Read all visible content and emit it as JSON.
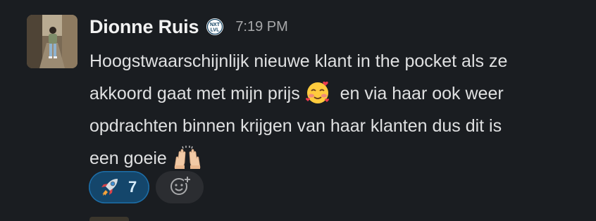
{
  "message": {
    "author": "Dionne Ruis",
    "status_badge_text": "NXT LVL",
    "timestamp": "7:19 PM",
    "lines": [
      "Hoogstwaarschijnlijk nieuwe klant in the pocket als ze",
      "akkoord gaat met mijn prijs",
      "en via haar ook weer",
      "opdrachten binnen krijgen van haar klanten dus dit is",
      "een goeie"
    ],
    "emojis": [
      "smiling-face-with-hearts-icon",
      "raising-hands-icon"
    ]
  },
  "reactions": [
    {
      "emoji": "rocket-icon",
      "count": "7",
      "active": true
    }
  ],
  "colors": {
    "background": "#1a1d21",
    "reaction_active_bg": "#14466b",
    "reaction_active_border": "#1d6ea8",
    "text": "#dfe0e1",
    "muted": "#a8a9ab"
  }
}
